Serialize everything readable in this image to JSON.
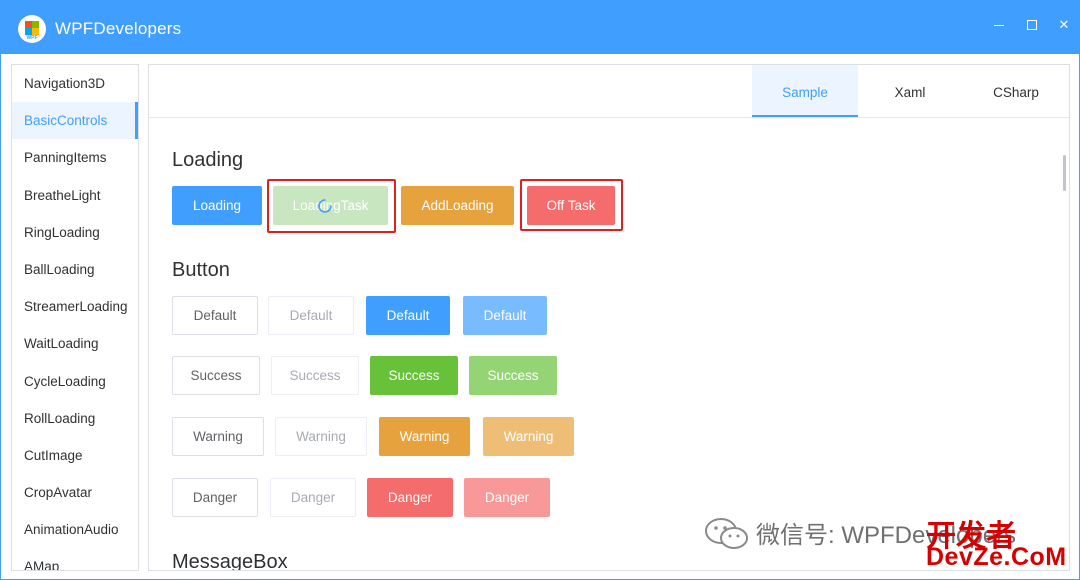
{
  "window": {
    "title": "WPFDevelopers",
    "logo_text": "WPF",
    "controls": [
      "minimize-icon",
      "maximize-icon",
      "close-icon"
    ],
    "close_glyph": "✕"
  },
  "sidebar": {
    "items": [
      {
        "label": "Navigation3D"
      },
      {
        "label": "BasicControls"
      },
      {
        "label": "PanningItems"
      },
      {
        "label": "BreatheLight"
      },
      {
        "label": "RingLoading"
      },
      {
        "label": "BallLoading"
      },
      {
        "label": "StreamerLoading"
      },
      {
        "label": "WaitLoading"
      },
      {
        "label": "CycleLoading"
      },
      {
        "label": "RollLoading"
      },
      {
        "label": "CutImage"
      },
      {
        "label": "CropAvatar"
      },
      {
        "label": "AnimationAudio"
      },
      {
        "label": "AMap"
      }
    ],
    "active": "BasicControls"
  },
  "tabs": [
    {
      "label": "Sample"
    },
    {
      "label": "Xaml"
    },
    {
      "label": "CSharp"
    }
  ],
  "loading_section": {
    "title": "Loading",
    "buttons": [
      {
        "label": "Loading"
      },
      {
        "label": "LoadingTask"
      },
      {
        "label": "AddLoading"
      },
      {
        "label": "Off Task"
      }
    ]
  },
  "button_section": {
    "title": "Button",
    "rows": [
      {
        "labels": [
          "Default",
          "Default",
          "Default",
          "Default"
        ]
      },
      {
        "labels": [
          "Success",
          "Success",
          "Success",
          "Success"
        ]
      },
      {
        "labels": [
          "Warning",
          "Warning",
          "Warning",
          "Warning"
        ]
      },
      {
        "labels": [
          "Danger",
          "Danger",
          "Danger",
          "Danger"
        ]
      }
    ]
  },
  "messagebox_section": {
    "title": "MessageBox"
  },
  "watermark": {
    "text": "微信号: WPFDevelopers",
    "site_cn": "开发者",
    "site_en": "DevZe.CoM"
  },
  "colors": {
    "primary": "#409EFF",
    "success": "#67C23A",
    "warning": "#E6A23C",
    "danger": "#F56C6C",
    "highlight": "#E02020"
  }
}
